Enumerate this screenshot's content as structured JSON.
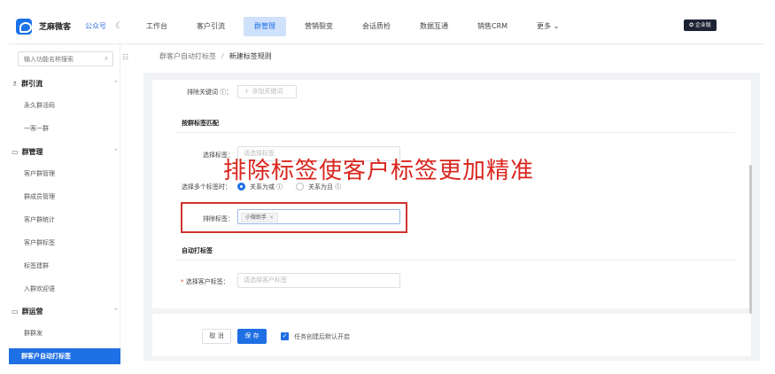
{
  "header": {
    "brand": "芝麻微客",
    "public_account": "公众号",
    "nav": [
      "工作台",
      "客户引流",
      "群管理",
      "营销裂变",
      "会话质检",
      "数据互通",
      "销售CRM",
      "更多 ⌄"
    ],
    "enterprise": "✪ 企业版"
  },
  "sidebar": {
    "search_placeholder": "输入功能名称搜索",
    "groups": [
      {
        "title": "群引流",
        "items": [
          "永久群活码",
          "一客一群"
        ]
      },
      {
        "title": "群管理",
        "items": [
          "客户群管理",
          "群成员管理",
          "客户群统计",
          "客户群标签",
          "标签建群",
          "入群欢迎语"
        ]
      },
      {
        "title": "群运营",
        "items": [
          "群群发",
          "群客户自动打标签"
        ]
      }
    ]
  },
  "breadcrumb": {
    "parent": "群客户自动打标签",
    "current": "新建标签规则"
  },
  "form": {
    "exclude_keyword_label": "排除关键词 ⓘ：",
    "add_keyword": "＋ 添加关键词",
    "section_group_tag": "按群标签匹配",
    "select_tag_label": "选择标签：",
    "select_tag_placeholder": "请选择标签",
    "multi_tag_label": "选择多个标签时：",
    "relation_or": "关系为或 ⓘ",
    "relation_and": "关系为且 ⓘ",
    "exclude_tag_label": "排除标签：",
    "exclude_tag_value": "小微助手",
    "section_auto_tag": "自动打标签",
    "customer_tag_label": "选择客户标签：",
    "customer_tag_placeholder": "请选择客户标签"
  },
  "annotation": "排除标签使客户标签更加精准",
  "footer": {
    "cancel": "取 消",
    "save": "保 存",
    "checkbox_label": "任务创建后默认开启"
  }
}
